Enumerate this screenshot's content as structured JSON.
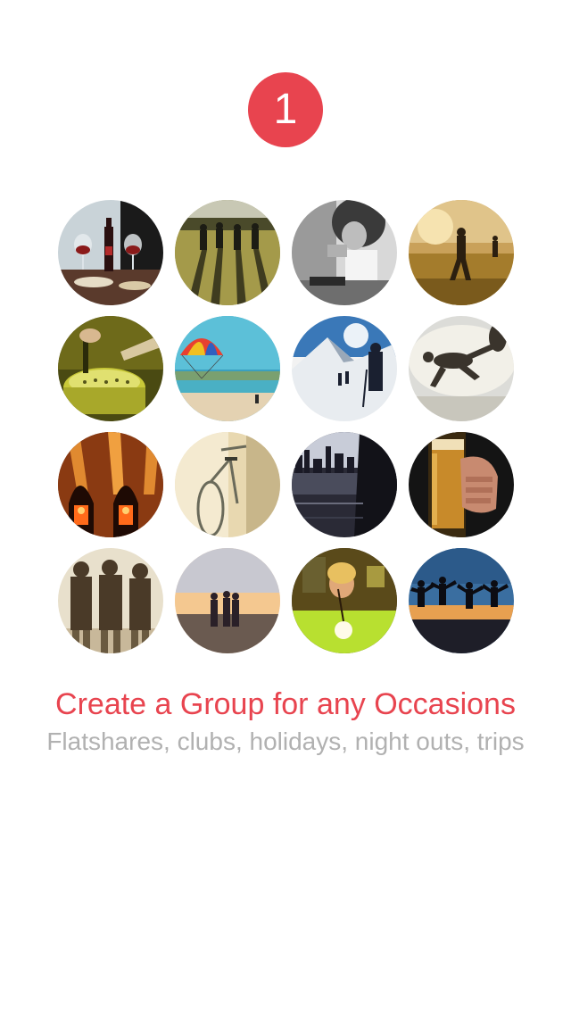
{
  "step": {
    "number": "1",
    "color": "#e8444f"
  },
  "photos": [
    {
      "name": "photo-wine-dinner",
      "subject": "wine bottle and glasses on a table"
    },
    {
      "name": "photo-runners-field",
      "subject": "group of runners on a field"
    },
    {
      "name": "photo-drink-cup",
      "subject": "person drinking from a cup, black and white"
    },
    {
      "name": "photo-sunset-run",
      "subject": "people running at sunset"
    },
    {
      "name": "photo-cooking-pot",
      "subject": "cooking over a pot"
    },
    {
      "name": "photo-paraglider-beach",
      "subject": "parachute over a beach"
    },
    {
      "name": "photo-snow-hikers",
      "subject": "hikers in the snow"
    },
    {
      "name": "photo-sky-jump",
      "subject": "people jumping against the sky"
    },
    {
      "name": "photo-candle-lanterns",
      "subject": "glowing candle lanterns"
    },
    {
      "name": "photo-bicycle",
      "subject": "bicycle in sunlight"
    },
    {
      "name": "photo-city-skyline",
      "subject": "city skyline by the water"
    },
    {
      "name": "photo-beer-glass",
      "subject": "hand holding a glass of beer"
    },
    {
      "name": "photo-friends-group",
      "subject": "group of friends standing together"
    },
    {
      "name": "photo-sunset-walk",
      "subject": "people walking at sunset"
    },
    {
      "name": "photo-billiards",
      "subject": "person playing billiards"
    },
    {
      "name": "photo-jump-silhouettes",
      "subject": "silhouettes jumping at sunset"
    }
  ],
  "heading": {
    "title": "Create a Group for any Occasions",
    "subtitle": "Flatshares, clubs, holidays, night outs, trips",
    "title_color": "#e8444f",
    "subtitle_color": "#b1b1b1"
  }
}
